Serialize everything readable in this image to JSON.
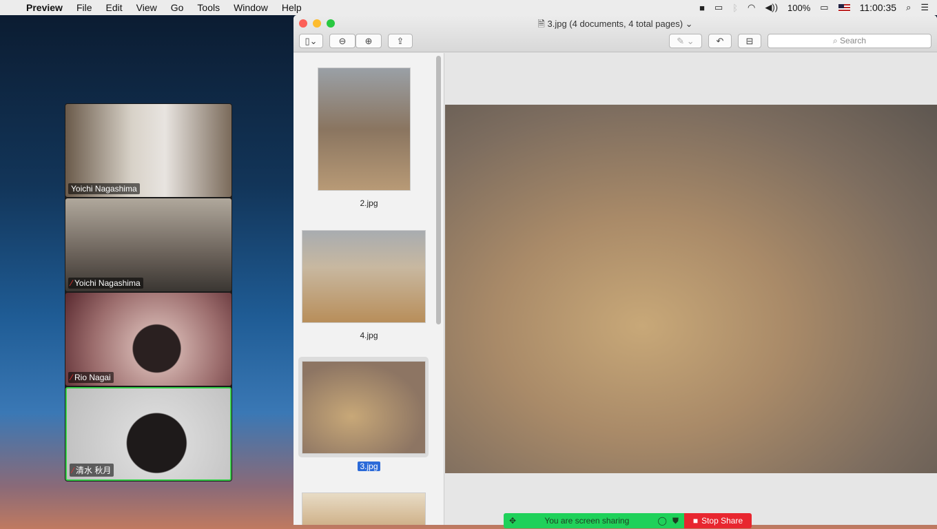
{
  "menubar": {
    "app": "Preview",
    "items": [
      "File",
      "Edit",
      "View",
      "Go",
      "Tools",
      "Window",
      "Help"
    ],
    "battery": "100%",
    "clock": "11:00:35"
  },
  "gallery": {
    "participants": [
      {
        "name": "Yoichi Nagashima",
        "muted": false
      },
      {
        "name": "Yoichi Nagashima",
        "muted": true
      },
      {
        "name": "Rio Nagai",
        "muted": true
      },
      {
        "name": "清水 秋月",
        "muted": true,
        "active_speaker": true
      }
    ]
  },
  "window": {
    "title": "3.jpg (4 documents, 4 total pages)",
    "search_placeholder": "Search",
    "thumbnails": [
      {
        "label": "2.jpg"
      },
      {
        "label": "4.jpg"
      },
      {
        "label": "3.jpg",
        "selected": true
      }
    ]
  },
  "sharing": {
    "status": "You are screen sharing",
    "stop_label": "Stop Share"
  }
}
